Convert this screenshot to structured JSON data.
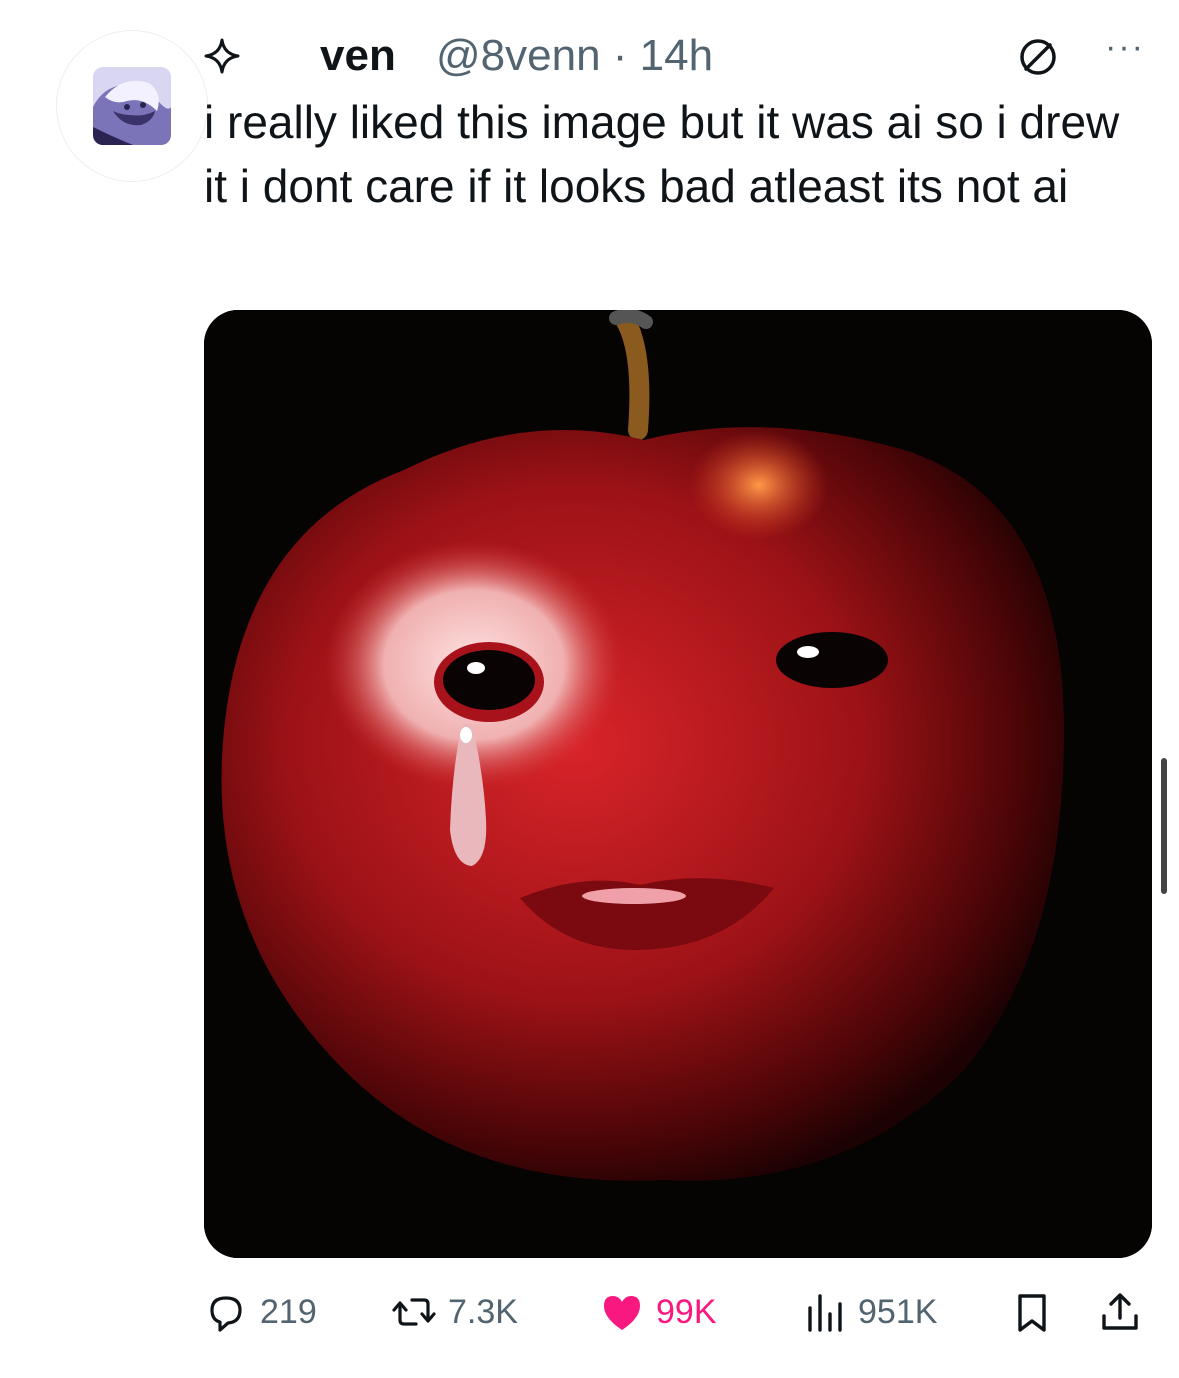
{
  "post": {
    "display_name": "ven",
    "handle_time": "@8venn · 14h",
    "text": "i really liked this image but it was ai so i drew it i dont care if it looks bad atleast its not ai",
    "more_label": "···"
  },
  "actions": {
    "replies": "219",
    "reposts": "7.3K",
    "likes": "99K",
    "views": "951K"
  },
  "icons": {
    "avatar": "avatar-image",
    "sparkle": "sparkle-icon",
    "verified": "no-entry-icon",
    "reply": "reply-icon",
    "repost": "repost-icon",
    "like": "heart-icon",
    "views": "views-icon",
    "bookmark": "bookmark-icon",
    "share": "share-icon"
  },
  "colors": {
    "like": "#f91880",
    "muted": "#536471",
    "text": "#0f1419",
    "apple": "#b3161c"
  }
}
